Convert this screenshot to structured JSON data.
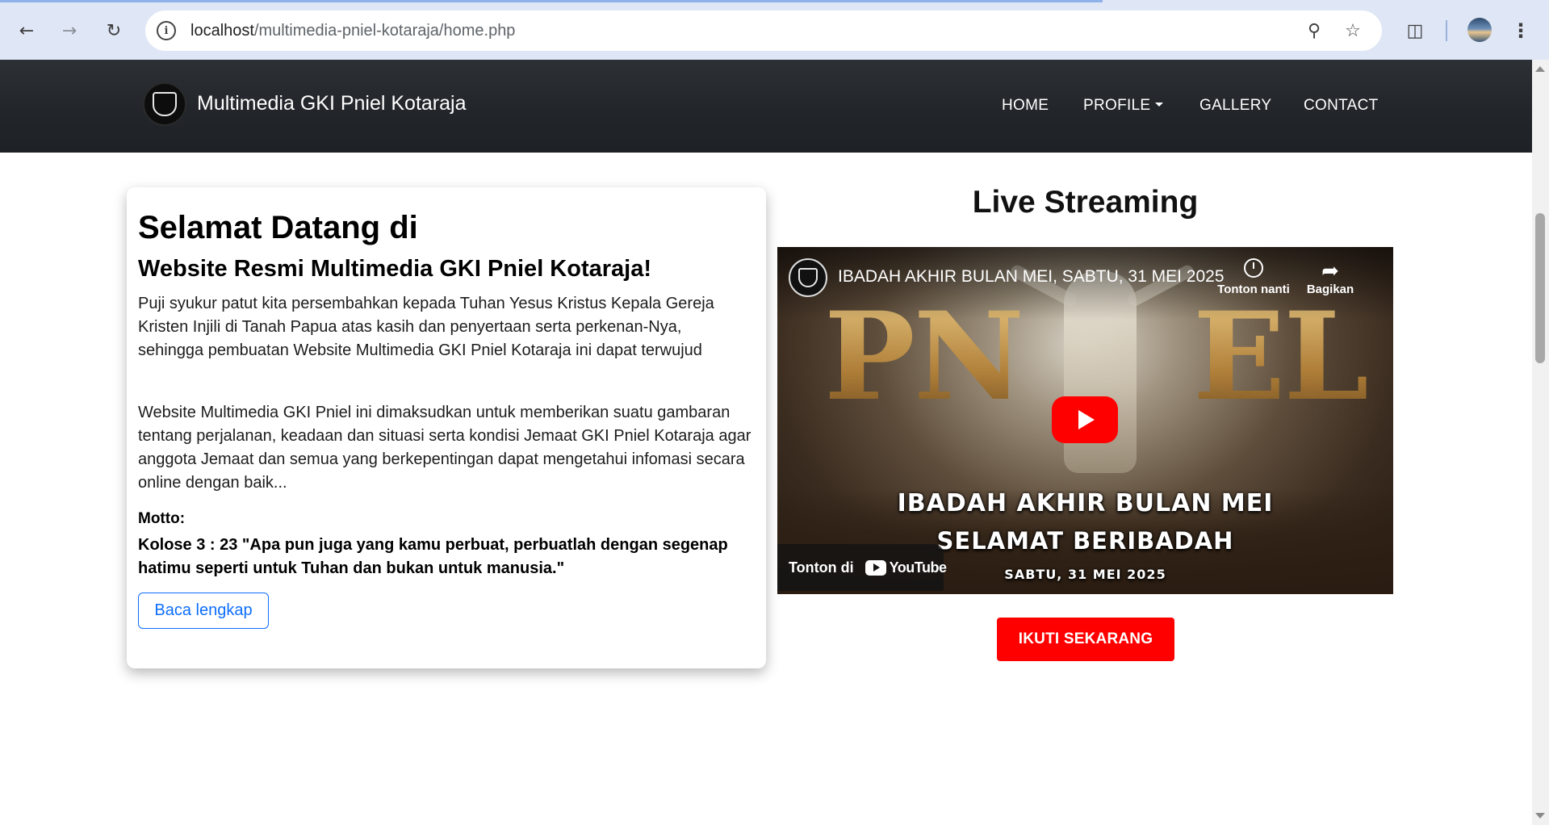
{
  "browser": {
    "url_host": "localhost",
    "url_path": "/multimedia-pniel-kotaraja/home.php",
    "icons": [
      "back-arrow-icon",
      "forward-arrow-icon",
      "reload-icon",
      "site-info-icon",
      "zoom-icon",
      "bookmark-star-icon",
      "extensions-icon",
      "profile-avatar",
      "menu-kebab-icon"
    ]
  },
  "navbar": {
    "brand": "Multimedia GKI Pniel Kotaraja",
    "links": [
      {
        "label": "HOME"
      },
      {
        "label": "PROFILE"
      },
      {
        "label": "GALLERY"
      },
      {
        "label": "CONTACT"
      }
    ]
  },
  "welcome": {
    "title": "Selamat Datang di",
    "subtitle": "Website Resmi Multimedia GKI Pniel Kotaraja!",
    "paragraph1": "Puji syukur patut kita persembahkan kepada Tuhan Yesus Kristus Kepala Gereja Kristen Injili di Tanah Papua atas kasih dan penyertaan serta perkenan-Nya, sehingga pembuatan Website Multimedia GKI Pniel Kotaraja ini dapat terwujud",
    "paragraph2": "Website Multimedia GKI Pniel ini dimaksudkan untuk memberikan suatu gambaran tentang perjalanan, keadaan dan situasi serta kondisi Jemaat GKI Pniel Kotaraja agar anggota Jemaat dan semua yang berkepentingan dapat mengetahui infomasi secara online dengan baik...",
    "motto_label": "Motto:",
    "motto_text": "Kolose 3 : 23 \"Apa pun juga yang kamu perbuat, perbuatlah dengan segenap hatimu seperti untuk Tuhan dan bukan untuk manusia.\"",
    "read_more": "Baca lengkap"
  },
  "live": {
    "title": "Live Streaming",
    "video": {
      "title": "IBADAH AKHIR BULAN MEI, SABTU, 31 MEI 2025",
      "watch_later": "Tonton nanti",
      "share": "Bagikan",
      "thumb_word_left": "PN",
      "thumb_word_right": "EL",
      "overlay_line1": "IBADAH AKHIR BULAN MEI",
      "overlay_line2": "SELAMAT BERIBADAH",
      "overlay_line3": "SABTU, 31 MEI 2025",
      "watch_on": "Tonton di",
      "youtube": "YouTube"
    },
    "cta": "IKUTI SEKARANG"
  },
  "colors": {
    "navbar_bg": "#22262a",
    "primary": "#0d6efd",
    "cta_red": "#ff0000",
    "chrome_bg": "#dfe6f5"
  }
}
